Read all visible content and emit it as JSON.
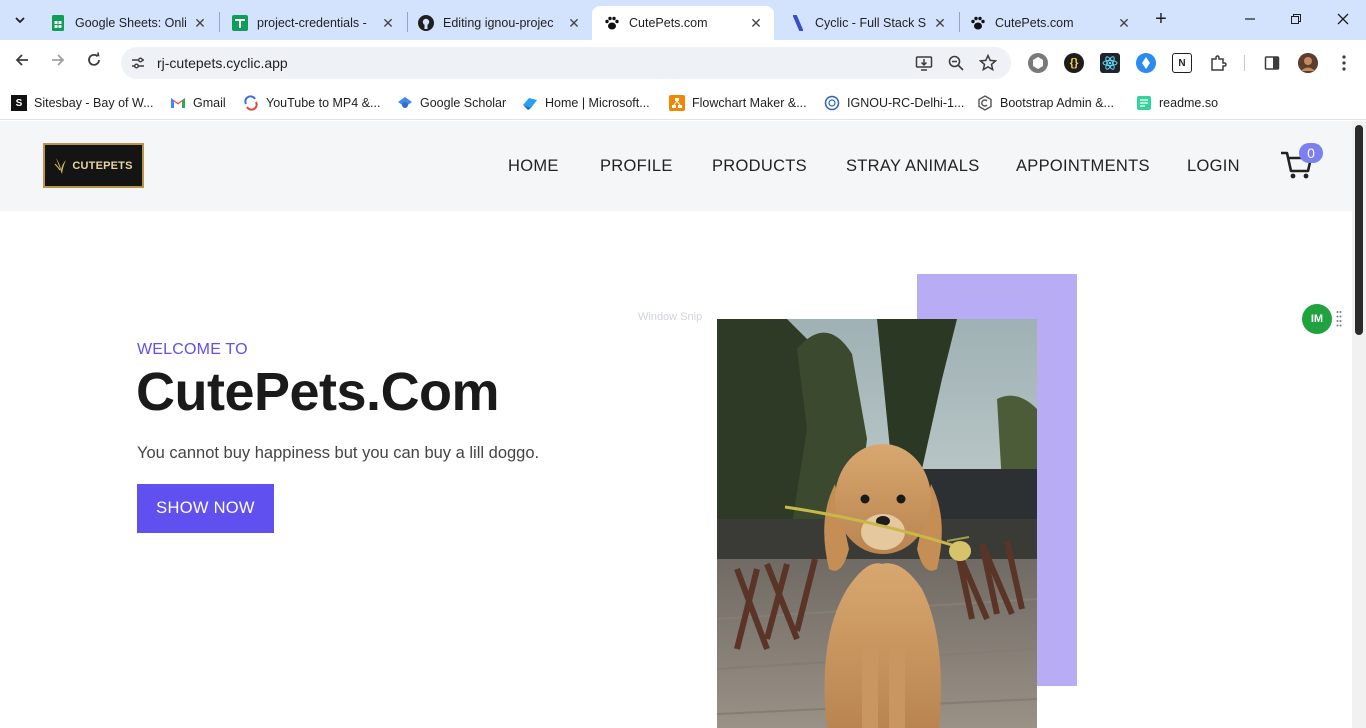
{
  "browser": {
    "tabs": [
      {
        "title": "Google Sheets: Onlin",
        "icon": "sheets-icon",
        "active": false
      },
      {
        "title": "project-credentials -",
        "icon": "sheets-icon",
        "active": false
      },
      {
        "title": "Editing ignou-projec",
        "icon": "github-icon",
        "active": false
      },
      {
        "title": "CutePets.com",
        "icon": "paw-icon",
        "active": true
      },
      {
        "title": "Cyclic - Full Stack Se",
        "icon": "cyclic-icon",
        "active": false
      },
      {
        "title": "CutePets.com",
        "icon": "paw-icon",
        "active": false
      }
    ],
    "url": "rj-cutepets.cyclic.app",
    "bookmarks": [
      {
        "label": "Sitesbay - Bay of W...",
        "icon": "sitesbay-icon"
      },
      {
        "label": "Gmail",
        "icon": "gmail-icon"
      },
      {
        "label": "YouTube to MP4 &...",
        "icon": "youtube-mp4-icon"
      },
      {
        "label": "Google Scholar",
        "icon": "scholar-icon"
      },
      {
        "label": "Home | Microsoft...",
        "icon": "microsoft-icon"
      },
      {
        "label": "Flowchart Maker &...",
        "icon": "drawio-icon"
      },
      {
        "label": "IGNOU-RC-Delhi-1...",
        "icon": "ignou-icon"
      },
      {
        "label": "Bootstrap Admin &...",
        "icon": "bootstrap-icon"
      },
      {
        "label": "readme.so",
        "icon": "readme-icon"
      }
    ]
  },
  "site": {
    "logo_text": "CUTEPETS",
    "nav": [
      "HOME",
      "PROFILE",
      "PRODUCTS",
      "STRAY ANIMALS",
      "APPOINTMENTS",
      "LOGIN"
    ],
    "cart_count": "0",
    "hero": {
      "eyebrow": "WELCOME TO",
      "title": "CutePets.Com",
      "subtitle": "You cannot buy happiness but you can buy a lill doggo.",
      "button": "SHOW NOW"
    },
    "overlay_text": "Window Snip",
    "extension_badge": "IM"
  },
  "colors": {
    "accent": "#5f50ef",
    "accent_light": "#b8adf5",
    "header_bg": "#f5f6f8",
    "tabstrip_bg": "#d3e3fd"
  }
}
